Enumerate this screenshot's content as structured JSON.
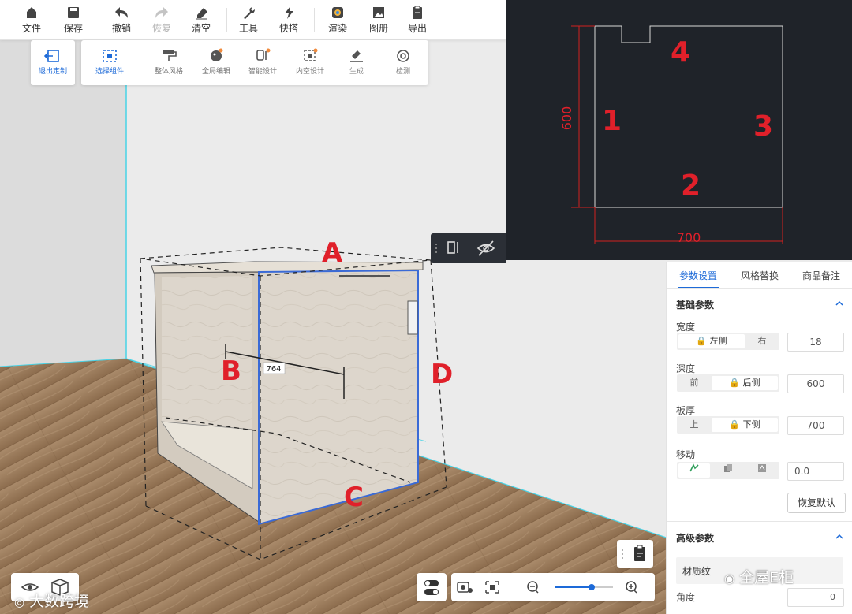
{
  "toolbar": {
    "file": "文件",
    "save": "保存",
    "undo": "撤销",
    "redo": "恢复",
    "clear": "清空",
    "tools": "工具",
    "quick": "快搭",
    "render": "渲染",
    "album": "图册",
    "export": "导出"
  },
  "subtoolbar": {
    "exit_custom": "退出定制",
    "select_component": "选择组件",
    "overall_style": "整体风格",
    "global_edit": "全局编辑",
    "smart_design": "智能设计",
    "inner_design": "内空设计",
    "generate": "生成",
    "detect": "检测"
  },
  "scene": {
    "dimension": "764",
    "label_a": "A",
    "label_b": "B",
    "label_c": "C",
    "label_d": "D"
  },
  "plan": {
    "dim_height": "600",
    "dim_width": "700",
    "side_1": "1",
    "side_2": "2",
    "side_3": "3",
    "side_4": "4"
  },
  "panel": {
    "tabs": [
      "参数设置",
      "风格替换",
      "商品备注"
    ],
    "basic_title": "基础参数",
    "width_label": "宽度",
    "width_left": "左侧",
    "width_right": "右",
    "width_value": "18",
    "depth_label": "深度",
    "depth_front": "前",
    "depth_back": "后侧",
    "depth_value": "600",
    "thick_label": "板厚",
    "thick_top": "上",
    "thick_bottom": "下侧",
    "thick_value": "700",
    "move_label": "移动",
    "move_value": "0.0",
    "reset_button": "恢复默认",
    "advanced_title": "高级参数",
    "material_label": "材质纹",
    "angle_label": "角度",
    "angle_value": "0"
  },
  "watermarks": {
    "left": "大数跨境",
    "right": "全屋E柜"
  }
}
